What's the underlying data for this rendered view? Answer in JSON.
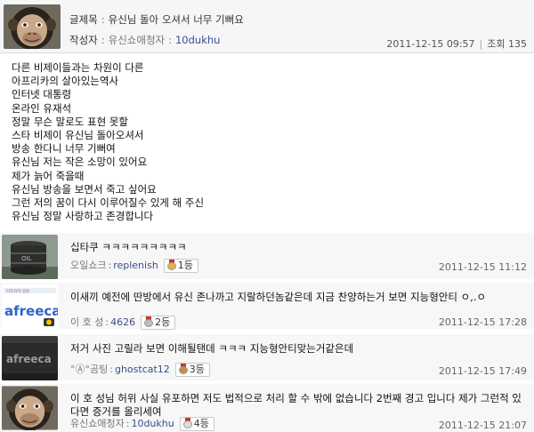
{
  "post": {
    "title_label": "글제목",
    "title": "유신님 돌아 오셔서 너무 기뻐요",
    "author_label": "작성자",
    "author_nick": "유신쇼애청자",
    "author_id": "10dukhu",
    "date": "2011-12-15 09:57",
    "views_label": "조회",
    "views": "135",
    "body_lines": [
      "다른 비제이들과는 차원이 다른",
      "아프리카의 살아있는역사",
      "인터넷 대통령",
      "온라인 유재석",
      "정말 무슨 말로도 표현 못할",
      "스타 비제이 유신님 돌아오셔서",
      "방송 한다니 너무 기뻐여",
      "유신님 저는 작은 소망이 있어요",
      "제가 늙어 죽을때",
      "유신님 방송을 보면서 죽고 싶어요",
      "그런 저의 꿈이 다시 이루어질수 있게 해 주신",
      "유신님 정말 사랑하고 존경합니다"
    ]
  },
  "comments": [
    {
      "text": "십타쿠 ㅋㅋㅋㅋㅋㅋㅋㅋㅋ",
      "nick": "오일쇼크",
      "user_id": "replenish",
      "rank": "1등",
      "date": "2011-12-15 11:12",
      "avatar": "oil-barrel-avatar",
      "medal_color": "#e0b64a"
    },
    {
      "text": "이새끼 예전에 딴방에서 유신 존나까고 지랄하던놈같은데 지금 찬양하는거 보면 지능형안티 ㅇ,.ㅇ",
      "nick": "이 호 성",
      "user_id": "4626",
      "rank": "2등",
      "date": "2011-12-15 17:28",
      "avatar": "afreeca-logo-avatar",
      "medal_color": "#b9bec4"
    },
    {
      "text": "저거 사진 고릴라 보면 이해될탠데 ㅋㅋㅋ 지능형안티맞는거같은데",
      "nick": "°Ⓐ°곰팅",
      "user_id": "ghostcat12",
      "rank": "3등",
      "date": "2011-12-15 17:49",
      "avatar": "afreeca-dark-avatar",
      "medal_color": "#c98b52"
    },
    {
      "text": "이 호 성님 허위 사실 유포하면 저도 법적으로 처리 할 수 밖에 없습니다 2번째 경고 입니다 제가 그런적 있다면 증거를 올리세여",
      "nick": "유신쇼애청자",
      "user_id": "10dukhu",
      "rank": "4등",
      "date": "2011-12-15 21:07",
      "avatar": "chimp-avatar",
      "medal_color": "#dcdcdc"
    }
  ]
}
